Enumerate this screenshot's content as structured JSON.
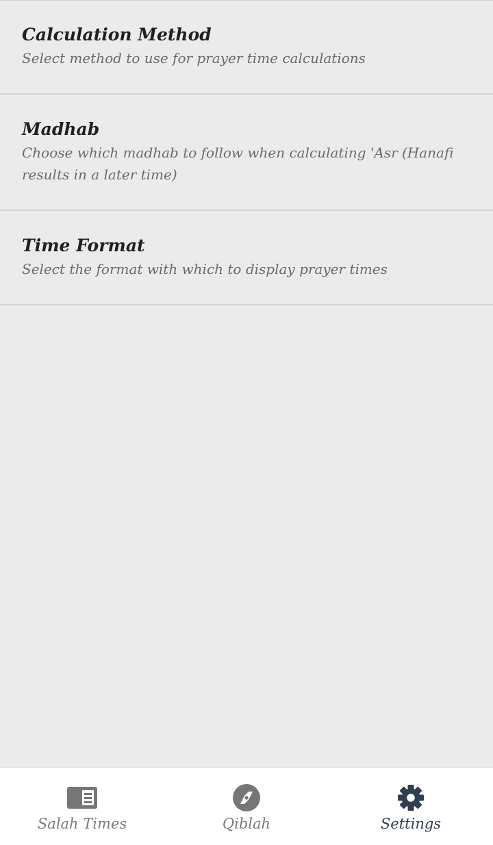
{
  "settings": {
    "items": [
      {
        "title": "Calculation Method",
        "subtitle": "Select method to use for prayer time calculations"
      },
      {
        "title": "Madhab",
        "subtitle": "Choose which madhab to follow when calculating 'Asr (Hanafi results in a later time)"
      },
      {
        "title": "Time Format",
        "subtitle": "Select the format with which to display prayer times"
      }
    ]
  },
  "bottom_nav": {
    "active": "Settings",
    "items": [
      {
        "label": "Salah Times",
        "icon": "list-view-icon"
      },
      {
        "label": "Qiblah",
        "icon": "compass-icon"
      },
      {
        "label": "Settings",
        "icon": "gear-icon"
      }
    ]
  },
  "colors": {
    "background": "#ebebeb",
    "nav_background": "#ffffff",
    "title_text": "#202020",
    "subtitle_text": "#6b6b6b",
    "inactive_icon": "#767676",
    "active_icon": "#2f3e50",
    "divider": "#d2d2d2"
  }
}
